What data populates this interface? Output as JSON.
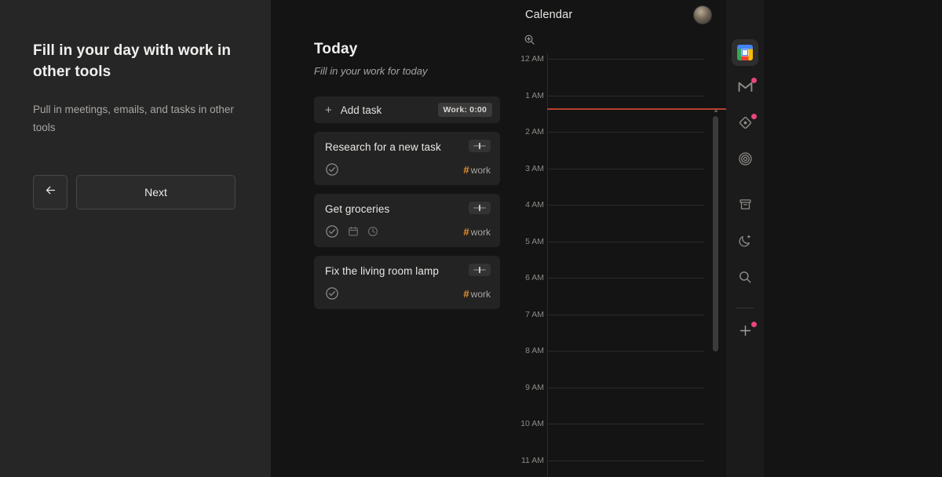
{
  "onboarding": {
    "title": "Fill in your day with work in other tools",
    "subtitle": "Pull in meetings, emails, and tasks in other tools",
    "back_label": "←",
    "back_icon": "arrow-left-icon",
    "next_label": "Next"
  },
  "tasks_panel": {
    "heading": "Today",
    "subheading": "Fill in your work for today",
    "add_task": {
      "plus": "+",
      "label": "Add task",
      "badge": "Work: 0:00"
    },
    "items": [
      {
        "title": "Research for a new task",
        "tag_hash": "#",
        "tag_label": "work",
        "icons": [
          "check-circle-icon"
        ],
        "slider_icon": "slider-adjust-icon"
      },
      {
        "title": "Get groceries",
        "tag_hash": "#",
        "tag_label": "work",
        "icons": [
          "check-circle-icon",
          "calendar-icon",
          "clock-icon"
        ],
        "slider_icon": "slider-adjust-icon"
      },
      {
        "title": "Fix the living room lamp",
        "tag_hash": "#",
        "tag_label": "work",
        "icons": [
          "check-circle-icon"
        ],
        "slider_icon": "slider-adjust-icon"
      }
    ]
  },
  "calendar": {
    "title": "Calendar",
    "avatar_icon": "user-avatar",
    "zoom_icon": "zoom-in-icon",
    "hours": [
      "12 AM",
      "1 AM",
      "2 AM",
      "3 AM",
      "4 AM",
      "5 AM",
      "6 AM",
      "7 AM",
      "8 AM",
      "9 AM",
      "10 AM",
      "11 AM"
    ],
    "now_line_color": "#b6402f",
    "now_line_hour_offset": 1.35
  },
  "rail": {
    "items": [
      {
        "icon": "google-calendar-icon",
        "active": true,
        "badge": false
      },
      {
        "icon": "gmail-icon",
        "active": false,
        "badge": true
      },
      {
        "icon": "asana-diamond-icon",
        "active": false,
        "badge": true
      },
      {
        "icon": "target-circle-icon",
        "active": false,
        "badge": false
      },
      {
        "icon": "archive-box-icon",
        "active": false,
        "badge": false
      },
      {
        "icon": "moon-sparkle-icon",
        "active": false,
        "badge": false
      },
      {
        "icon": "search-icon",
        "active": false,
        "badge": false
      },
      {
        "icon": "plus-icon",
        "active": false,
        "badge": true
      }
    ],
    "badge_color": "#e8467c"
  }
}
